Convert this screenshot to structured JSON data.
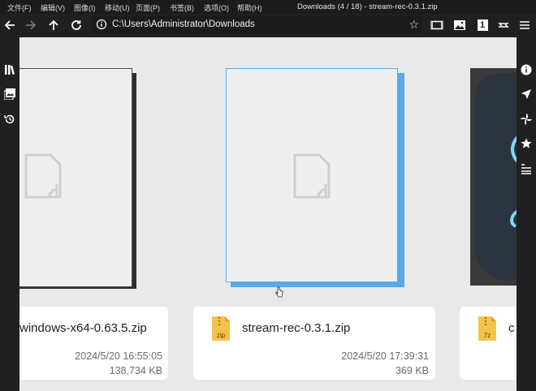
{
  "menubar": {
    "items": [
      "文件(F)",
      "编辑(V)",
      "图像(I)",
      "移动(U)",
      "页面(P)",
      "书签(B)",
      "选项(O)",
      "帮助(H)"
    ],
    "title": "Downloads (4 / 18) - stream-rec-0.3.1.zip"
  },
  "toolbar": {
    "address": "C:\\Users\\Administrator\\Downloads",
    "page_badge": "1"
  },
  "files": [
    {
      "name": "windows-x64-0.63.5.zip",
      "date": "2024/5/20 16:55:05",
      "size": "138,734 KB",
      "type_label": ""
    },
    {
      "name": "stream-rec-0.3.1.zip",
      "date": "2024/5/20 17:39:31",
      "size": "369 KB",
      "type_label": "zip"
    },
    {
      "name": "c",
      "date": "",
      "size": "",
      "type_label": "7z"
    }
  ],
  "colors": {
    "selection": "#5aa8e6",
    "shadow_dark": "#2d2d2d",
    "accent_icon": "#7fd8f0",
    "folder_yellow": "#f2c24a"
  }
}
